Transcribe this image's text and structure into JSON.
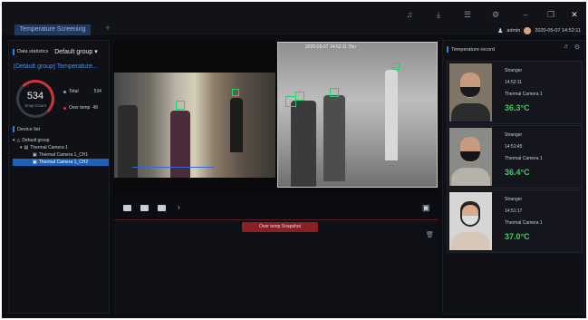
{
  "titlebar": {
    "tab_label": "Temperature Screening",
    "add_tab": "+",
    "icons": [
      "bell-icon",
      "download-icon",
      "menu-icon",
      "settings-icon",
      "minimize-icon",
      "restore-icon",
      "close-icon"
    ],
    "user": "admin",
    "datetime": "2020-05-07 14:52:11"
  },
  "left_panel": {
    "data_statistics_label": "Data statistics",
    "group_select": "Default group",
    "stat_title": "[Default group] Temperature...",
    "snap_count": "534",
    "snap_count_label": "Snap Count",
    "total_label": "Total",
    "total_value": "534",
    "over_temp_label": "Over temp",
    "over_temp_value": "48",
    "device_list_label": "Device list",
    "tree": [
      "Default group",
      "Thermal Camera 1",
      "Thermal Camera 1_CH1",
      "Thermal Camera 1_CH2"
    ]
  },
  "video": {
    "thermal_timestamp": "2020-05-07 14:52:11 Thu"
  },
  "snapshot": {
    "tab_label": "Over temp Snapshot"
  },
  "temperature_record": {
    "title": "Temperature record",
    "records": [
      {
        "type": "Stranger",
        "time": "14:52:11",
        "device": "Thermal Camera 1",
        "temp": "36.3°C"
      },
      {
        "type": "Stranger",
        "time": "14:51:45",
        "device": "Thermal Camera 1",
        "temp": "36.4°C"
      },
      {
        "type": "Stranger",
        "time": "14:51:17",
        "device": "Thermal Camera 1",
        "temp": "37.0°C"
      }
    ]
  },
  "colors": {
    "accent": "#2d7fe6",
    "alarm": "#d0353a",
    "normal_temp": "#3ecf5a",
    "background": "#0c0d12"
  }
}
